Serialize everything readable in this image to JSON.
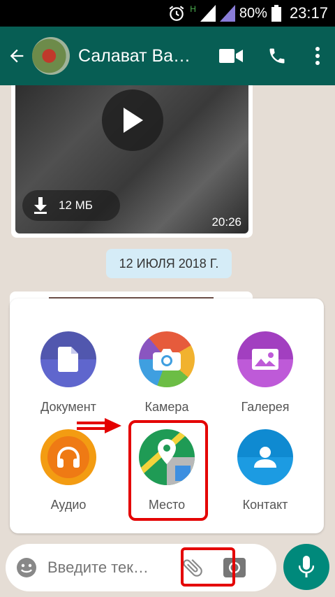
{
  "status": {
    "battery": "80%",
    "time": "23:17",
    "network": "H"
  },
  "header": {
    "title": "Салават Ва…"
  },
  "video": {
    "size": "12 МБ",
    "duration": "20:26"
  },
  "date_chip": "12 ИЮЛЯ 2018 Г.",
  "attach": {
    "document": "Документ",
    "camera": "Камера",
    "gallery": "Галерея",
    "audio": "Аудио",
    "location": "Место",
    "contact": "Контакт"
  },
  "input": {
    "placeholder": "Введите тек…"
  },
  "colors": {
    "app_bar": "#075e54",
    "accent": "#00897b",
    "highlight": "#e40000"
  }
}
